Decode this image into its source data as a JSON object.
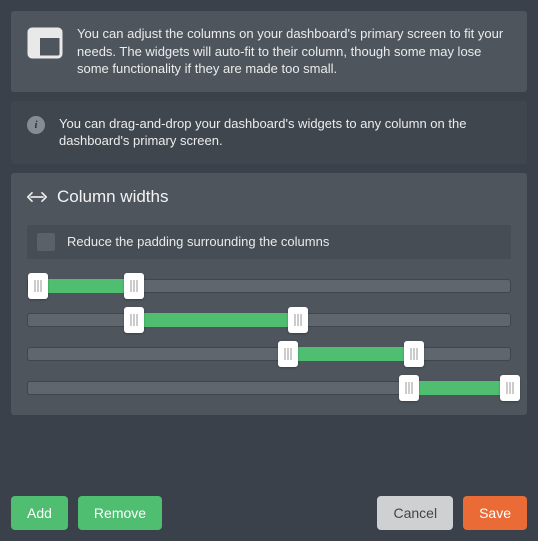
{
  "intro": {
    "text": "You can adjust the columns on your dashboard's primary screen to fit your needs. The widgets will auto-fit to their column, though some may lose some functionality if they are made too small."
  },
  "hint": {
    "text": "You can drag-and-drop your dashboard's widgets to any column on the dashboard's primary screen."
  },
  "section": {
    "title": "Column widths",
    "checkbox_label": "Reduce the padding surrounding the columns",
    "checkbox_checked": false,
    "sliders": [
      {
        "start_pct": 2,
        "end_pct": 22
      },
      {
        "start_pct": 22,
        "end_pct": 56
      },
      {
        "start_pct": 54,
        "end_pct": 80
      },
      {
        "start_pct": 79,
        "end_pct": 100
      }
    ]
  },
  "buttons": {
    "add": "Add",
    "remove": "Remove",
    "cancel": "Cancel",
    "save": "Save"
  }
}
